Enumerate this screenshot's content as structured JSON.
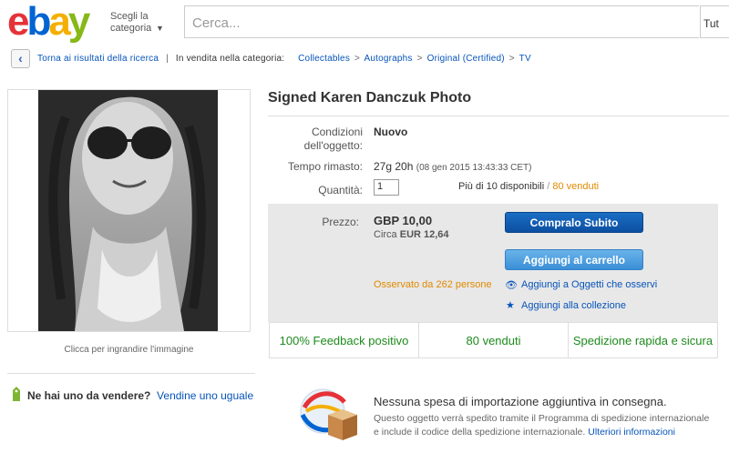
{
  "header": {
    "logo": {
      "e": "e",
      "b": "b",
      "a": "a",
      "y": "y"
    },
    "category_line1": "Scegli la",
    "category_line2": "categoria",
    "search_placeholder": "Cerca...",
    "search_category": "Tut"
  },
  "breadcrumb": {
    "back": "Torna ai risultati della ricerca",
    "in_sale": "In vendita nella categoria:",
    "items": [
      "Collectables",
      "Autographs",
      "Original (Certified)",
      "TV"
    ]
  },
  "image": {
    "enlarge": "Clicca per ingrandire l'immagine"
  },
  "sell": {
    "question": "Ne hai uno da vendere?",
    "link": "Vendine uno uguale"
  },
  "item": {
    "title": "Signed Karen Danczuk Photo",
    "condition_label_1": "Condizioni",
    "condition_label_2": "dell'oggetto:",
    "condition": "Nuovo",
    "time_label": "Tempo rimasto:",
    "time_left": "27g 20h",
    "time_end": "(08 gen 2015  13:43:33 CET)",
    "qty_label": "Quantità:",
    "qty_value": "1",
    "available": "Più di 10 disponibili",
    "sold": "80 venduti",
    "price_label": "Prezzo:",
    "price": "GBP 10,00",
    "approx_label": "Circa",
    "approx": "EUR 12,64",
    "buy_now": "Compralo Subito",
    "add_cart": "Aggiungi al carrello",
    "watched": "Osservato da 262 persone",
    "watch_link": "Aggiungi a Oggetti che osservi",
    "collection_link": "Aggiungi alla collezione"
  },
  "features": [
    "100% Feedback positivo",
    "80 venduti",
    "Spedizione rapida e sicura"
  ],
  "shipping": {
    "title": "Nessuna spesa di importazione aggiuntiva in consegna.",
    "text": "Questo oggetto verrà spedito tramite il Programma di spedizione internazionale e include il codice della spedizione internazionale.",
    "link_1": "Ulteriori",
    "link_2": "informazioni"
  },
  "colors": {
    "accent_blue": "#0654ba",
    "orange": "#e08a00",
    "green": "#1c8a1c"
  }
}
